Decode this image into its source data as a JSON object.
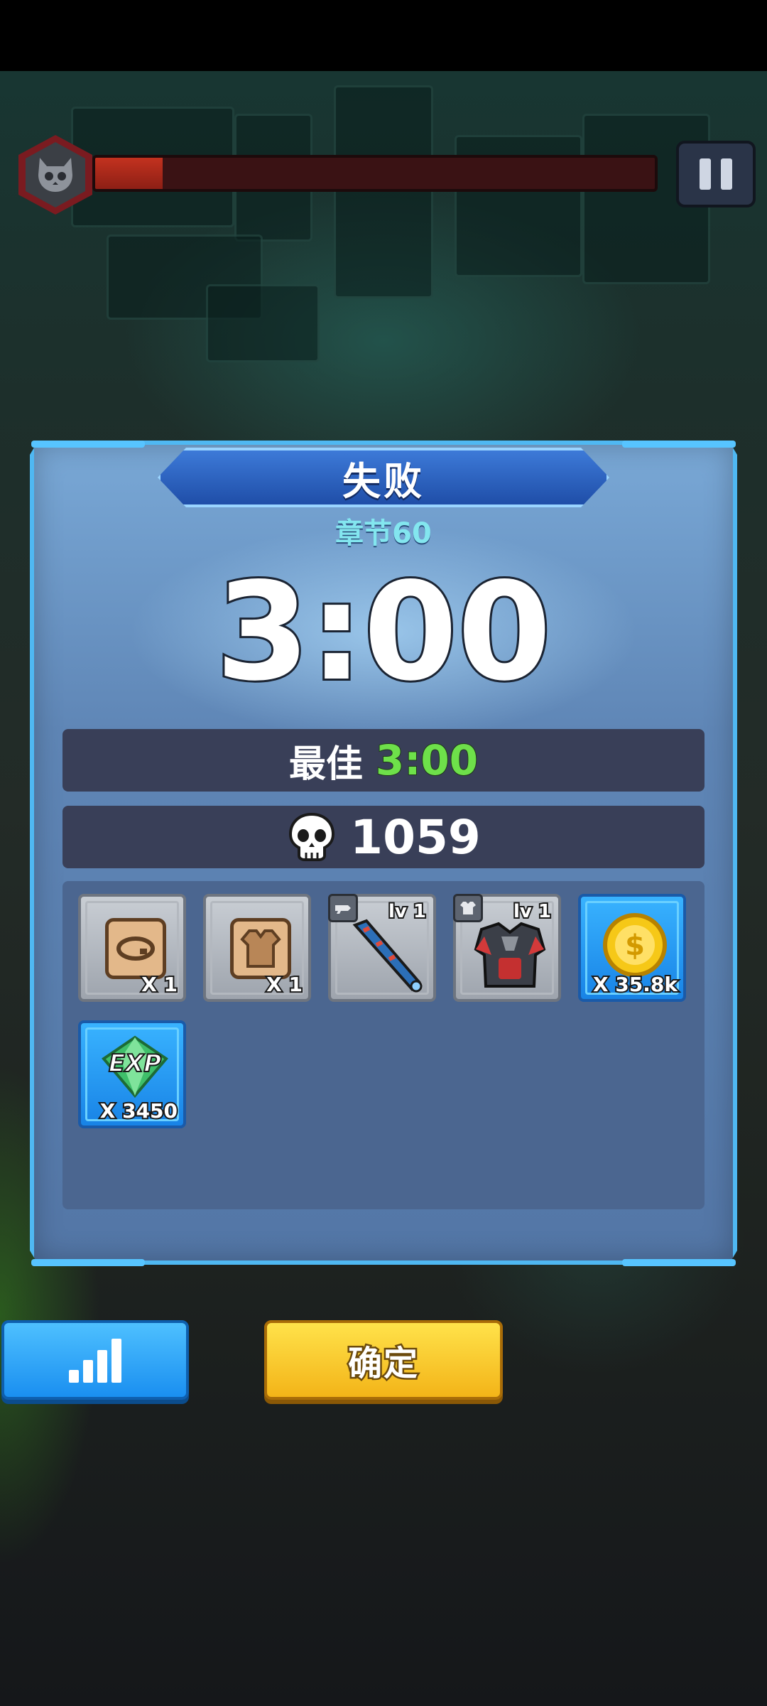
{
  "hud": {
    "boss_icon": "boss-skull-icon",
    "boss_health_fraction": 0.12,
    "pause_icon": "pause-icon"
  },
  "dialog": {
    "title": "失败",
    "chapter": "章节60",
    "time": "3:00",
    "best_label": "最佳",
    "best_value": "3:00",
    "kills_icon": "skull-icon",
    "kills": "1059"
  },
  "rewards": [
    {
      "icon": "collar-scroll-icon",
      "frame": "gray",
      "quantity": "X 1"
    },
    {
      "icon": "armor-scroll-icon",
      "frame": "gray",
      "quantity": "X 1"
    },
    {
      "icon": "baseball-bat-icon",
      "frame": "gray",
      "level": "lv 1",
      "tag_icon": "weapon-type-icon"
    },
    {
      "icon": "chest-armor-icon",
      "frame": "gray",
      "level": "lv 1",
      "tag_icon": "armor-type-icon"
    },
    {
      "icon": "gold-coin-icon",
      "frame": "blue",
      "quantity": "X 35.8k"
    },
    {
      "icon": "exp-gem-icon",
      "frame": "blue",
      "quantity": "X 3450"
    }
  ],
  "buttons": {
    "stats_icon": "signal-bars-icon",
    "confirm_label": "确定"
  },
  "colors": {
    "panel": "#5f86b6",
    "panel_border": "#4fb8f2",
    "best_value": "#6ee04a",
    "chapter": "#83e6ef",
    "confirm_button": "#f3b418",
    "stats_button": "#1a8ff0"
  }
}
